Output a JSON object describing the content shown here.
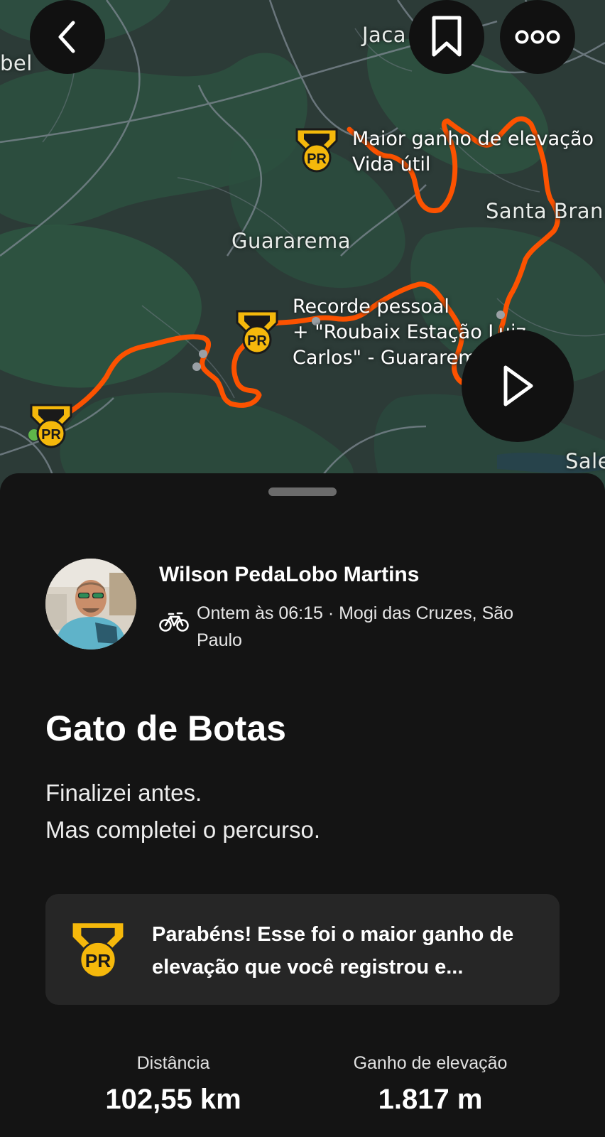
{
  "map": {
    "places": {
      "jacarei": "Jaca",
      "isabel": "bel",
      "guararema": "Guararema",
      "santa_branca": "Santa Bran",
      "salesopolis": "Sale"
    },
    "pr_labels": {
      "top": "Maior ganho de elevação\nVida útil",
      "middle": "Recorde pessoal\n+ \"Roubaix Estação Luiz\nCarlos\" - Guararema"
    },
    "pr_badge_text": "PR",
    "route_color": "#fc5200",
    "buttons": {
      "back_icon": "chevron-left-icon",
      "save_icon": "bookmark-icon",
      "more_icon": "more-horizontal-icon",
      "play_icon": "play-icon"
    }
  },
  "activity": {
    "athlete_name": "Wilson PedaLobo Martins",
    "sport_icon": "bike-icon",
    "meta": "Ontem às 06:15 · Mogi das Cruzes, São Paulo",
    "title": "Gato de Botas",
    "description": "Finalizei antes.\nMas completei o percurso.",
    "achievement": {
      "badge_text": "PR",
      "text": "Parabéns! Esse foi o maior ganho de elevação que você registrou e..."
    },
    "stats": [
      {
        "label": "Distância",
        "value": "102,55 km"
      },
      {
        "label": "Ganho de elevação",
        "value": "1.817 m"
      }
    ]
  },
  "colors": {
    "badge": "#f5b80b",
    "background": "#141414",
    "card": "#262626"
  }
}
